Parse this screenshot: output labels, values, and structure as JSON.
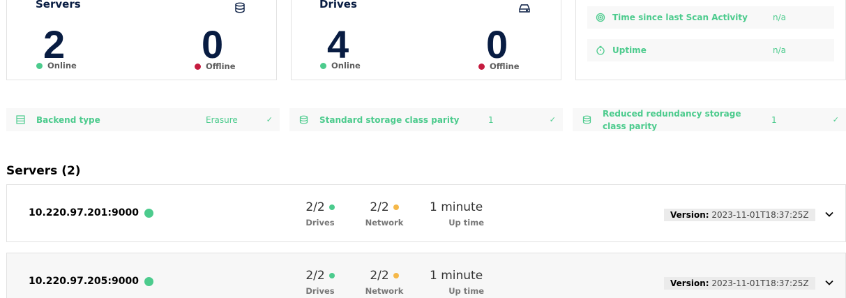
{
  "servers_card": {
    "title": "Servers",
    "icon": "database-icon",
    "online_count": "2",
    "online_label": "Online",
    "offline_count": "0",
    "offline_label": "Offline"
  },
  "drives_card": {
    "title": "Drives",
    "icon": "hard-drive-icon",
    "online_count": "4",
    "online_label": "Online",
    "offline_count": "0",
    "offline_label": "Offline"
  },
  "activity_card": {
    "rows": [
      {
        "icon": "scan-activity-icon",
        "label": "Time since last Scan Activity",
        "value": "n/a"
      },
      {
        "icon": "uptime-icon",
        "label": "Uptime",
        "value": "n/a"
      }
    ]
  },
  "properties": [
    {
      "icon": "backend-icon",
      "label": "Backend type",
      "value": "Erasure",
      "check": "✓"
    },
    {
      "icon": "storage-class-icon",
      "label": "Standard storage class parity",
      "value": "1",
      "check": "✓"
    },
    {
      "icon": "storage-class-icon",
      "label": "Reduced redundancy storage class parity",
      "value": "1",
      "check": "✓"
    }
  ],
  "servers_section": {
    "title": "Servers (2)",
    "rows": [
      {
        "endpoint": "10.220.97.201:9000",
        "drives": "2/2",
        "drives_label": "Drives",
        "network": "2/2",
        "network_label": "Network",
        "uptime": "1 minute",
        "uptime_label": "Up time",
        "version_label": "Version:",
        "version": "2023-11-01T18:37:25Z"
      },
      {
        "endpoint": "10.220.97.205:9000",
        "drives": "2/2",
        "drives_label": "Drives",
        "network": "2/2",
        "network_label": "Network",
        "uptime": "1 minute",
        "uptime_label": "Up time",
        "version_label": "Version:",
        "version": "2023-11-01T18:37:25Z"
      }
    ]
  },
  "colors": {
    "accent_green": "#4ccb8d",
    "offline_red": "#c51b3f",
    "warning_orange": "#f5b849",
    "navy": "#081c42"
  }
}
